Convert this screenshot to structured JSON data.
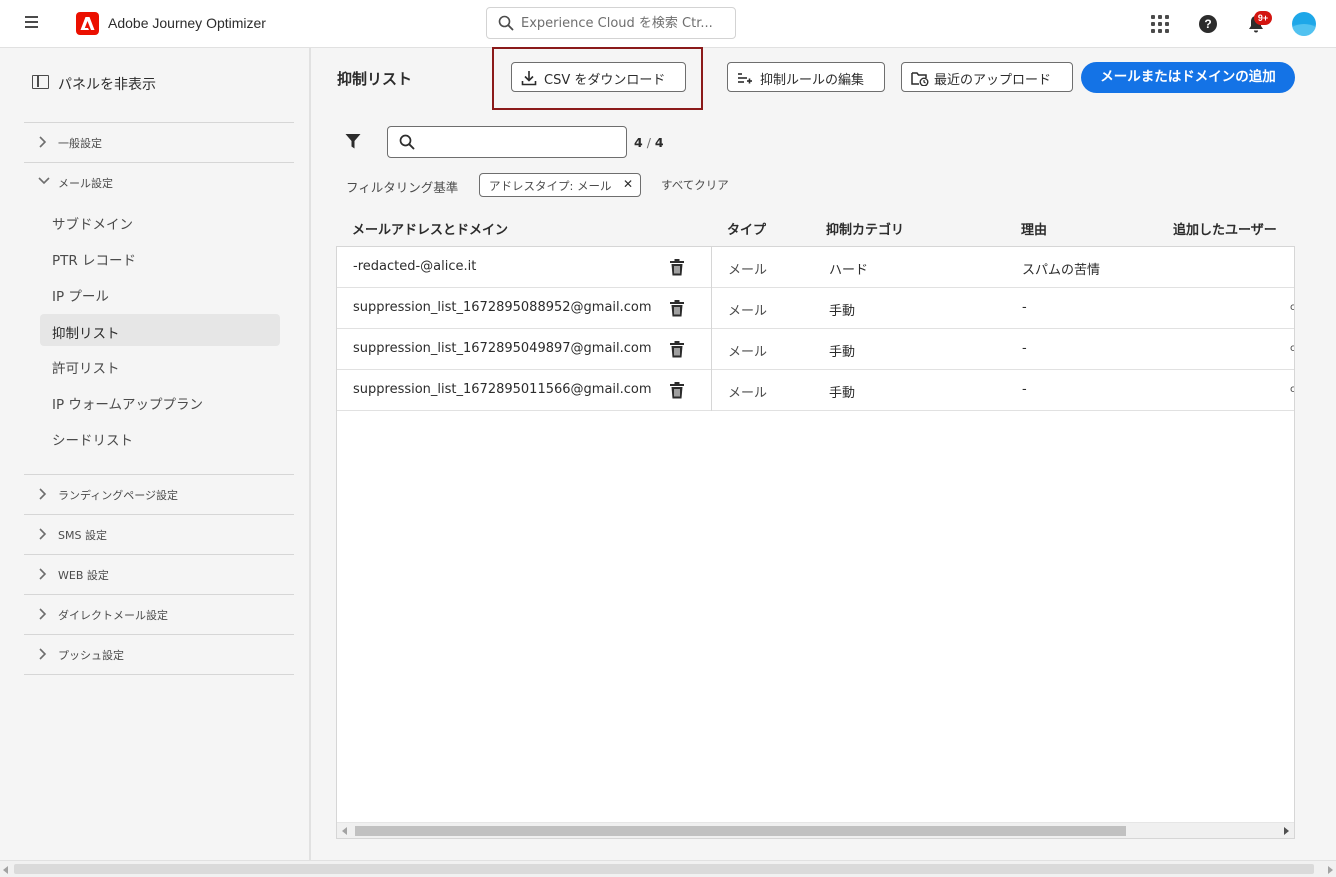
{
  "header": {
    "app_title": "Adobe Journey Optimizer",
    "search_placeholder": "Experience Cloud を検索 Ctr...",
    "notification_badge": "9+",
    "brand_color": "#eb1000"
  },
  "sidebar": {
    "hide_panel_label": "パネルを非表示",
    "groups": [
      {
        "label": "一般設定",
        "expanded": false
      },
      {
        "label": "メール設定",
        "expanded": true
      },
      {
        "label": "ランディングページ設定",
        "expanded": false
      },
      {
        "label": "SMS 設定",
        "expanded": false
      },
      {
        "label": "WEB 設定",
        "expanded": false
      },
      {
        "label": "ダイレクトメール設定",
        "expanded": false
      },
      {
        "label": "プッシュ設定",
        "expanded": false
      }
    ],
    "email_items": [
      {
        "label": "サブドメイン"
      },
      {
        "label": "PTR レコード"
      },
      {
        "label": "IP プール"
      },
      {
        "label": "抑制リスト",
        "active": true
      },
      {
        "label": "許可リスト"
      },
      {
        "label": "IP ウォームアッププラン"
      },
      {
        "label": "シードリスト"
      }
    ]
  },
  "main": {
    "title": "抑制リスト",
    "download_csv_label": "CSV をダウンロード",
    "edit_rules_label": "抑制ルールの編集",
    "recent_uploads_label": "最近のアップロード",
    "add_button_label": "メールまたはドメインの追加",
    "primary_color": "#1473e6",
    "highlight_color": "#8b1a1a",
    "count_shown": "4",
    "count_sep": "/",
    "count_total": "4",
    "filter_by_label": "フィルタリング基準",
    "filter_chip_label": "アドレスタイプ: メール",
    "clear_all_label": "すべてクリア"
  },
  "table": {
    "columns": [
      "メールアドレスとドメイン",
      "タイプ",
      "抑制カテゴリ",
      "理由",
      "追加したユーザー"
    ],
    "rows": [
      {
        "email": "-redacted-@alice.it",
        "type": "メール",
        "category": "ハード",
        "reason": "スパムの苦情"
      },
      {
        "email": "suppression_list_1672895088952@gmail.com",
        "type": "メール",
        "category": "手動",
        "reason": "-"
      },
      {
        "email": "suppression_list_1672895049897@gmail.com",
        "type": "メール",
        "category": "手動",
        "reason": "-"
      },
      {
        "email": "suppression_list_1672895011566@gmail.com",
        "type": "メール",
        "category": "手動",
        "reason": "-"
      }
    ]
  }
}
